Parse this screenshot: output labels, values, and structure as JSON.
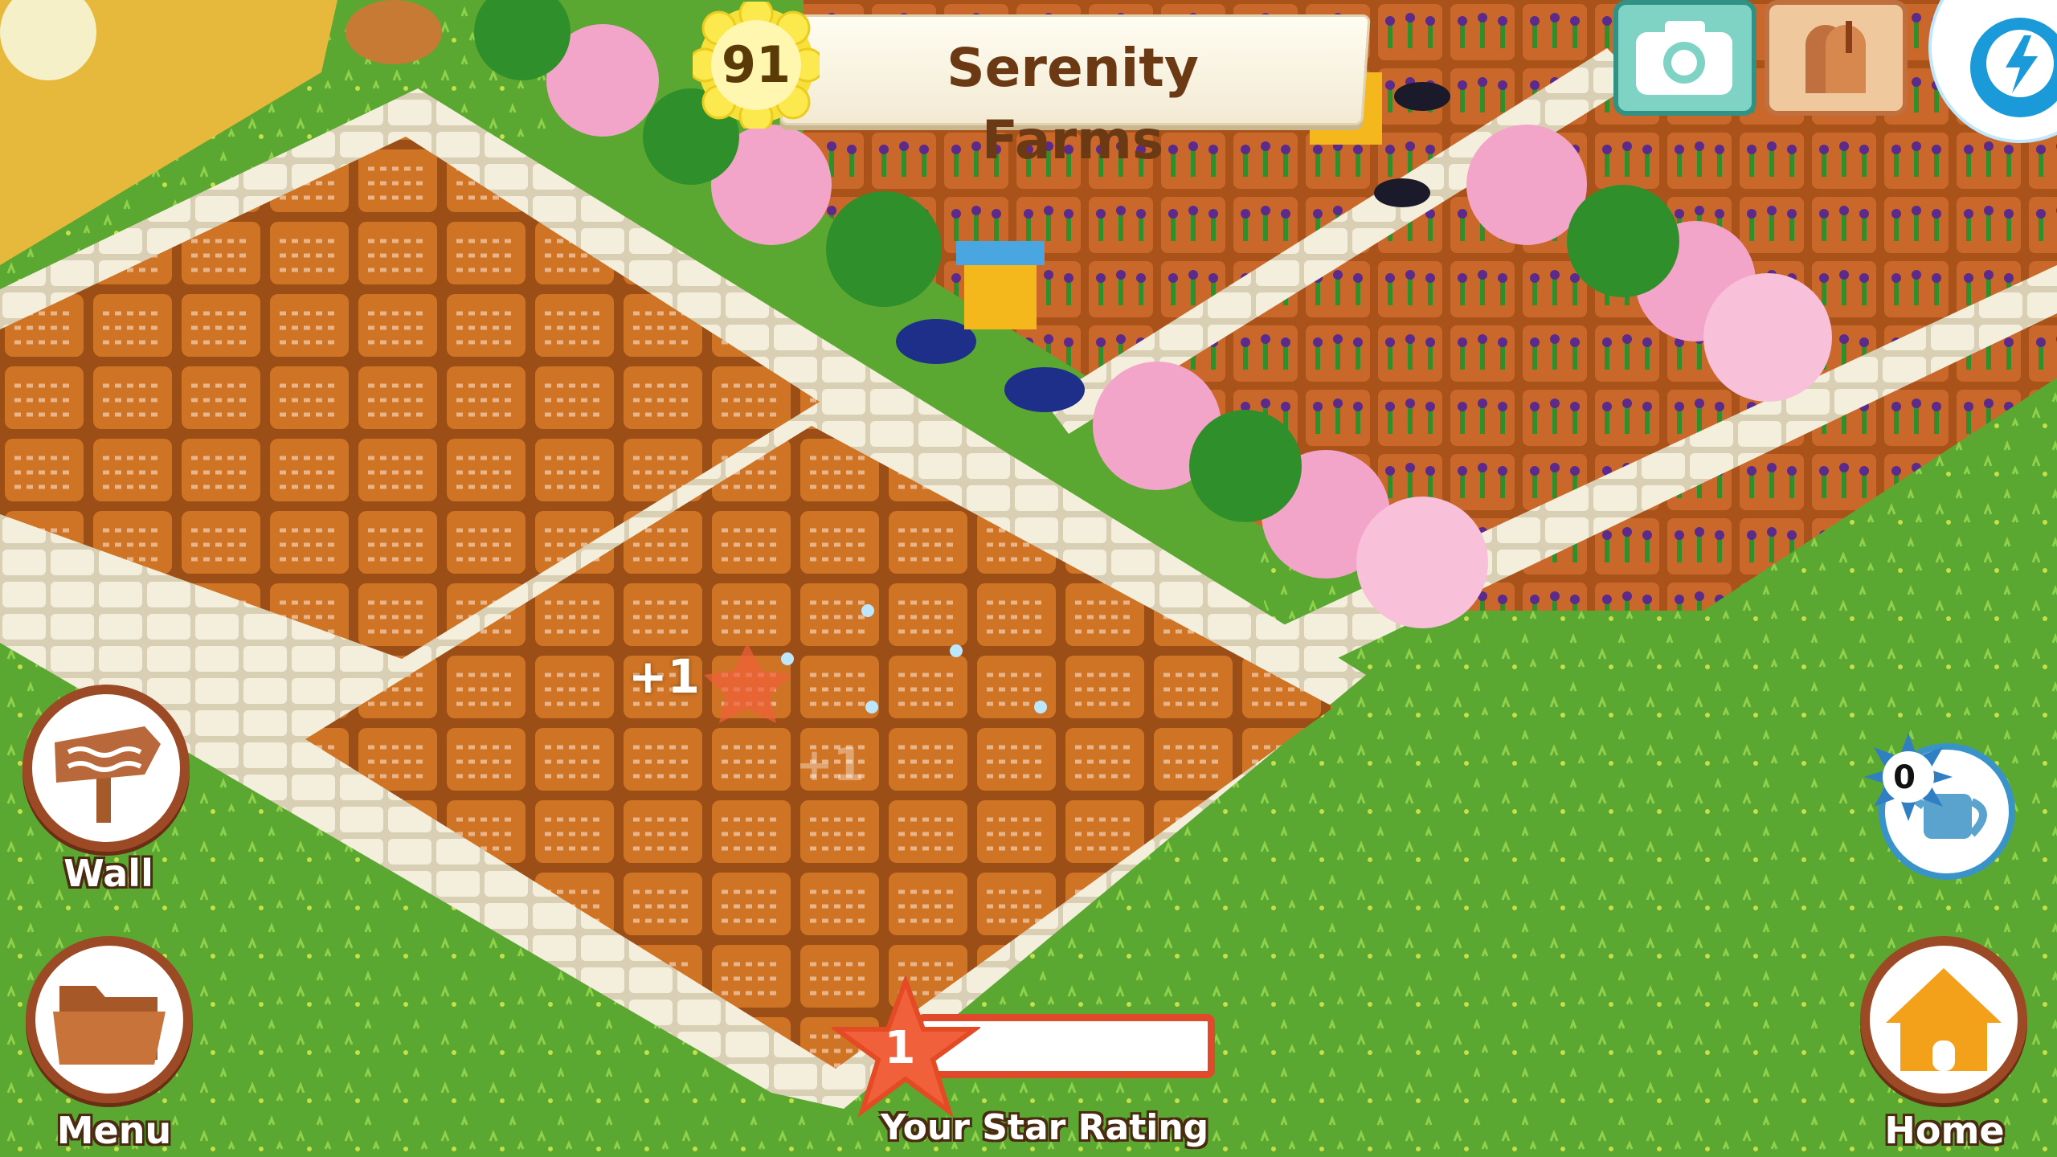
{
  "game": {
    "farm_name": "Serenity Farms",
    "level": "91",
    "water_count": "0",
    "star_level": "1",
    "star_progress": 0.0,
    "floating_rewards": [
      "+1",
      "+1"
    ]
  },
  "buttons": {
    "wall": "Wall",
    "menu": "Menu",
    "home": "Home",
    "star_rating": "Your Star Rating"
  },
  "icons": {
    "camera": "camera-icon",
    "mailbox": "mailbox-icon",
    "energy": "energy-icon",
    "watering_can": "watering-can-icon",
    "folder": "folder-icon",
    "signpost": "signpost-icon",
    "house": "house-icon",
    "star": "star-icon",
    "sun_badge": "sun-badge-icon"
  },
  "colors": {
    "grass": "#5aa832",
    "soil": "#c86a1f",
    "banner_text": "#6b3a14",
    "star_orange": "#f0603a",
    "button_border": "#9b4a25"
  }
}
